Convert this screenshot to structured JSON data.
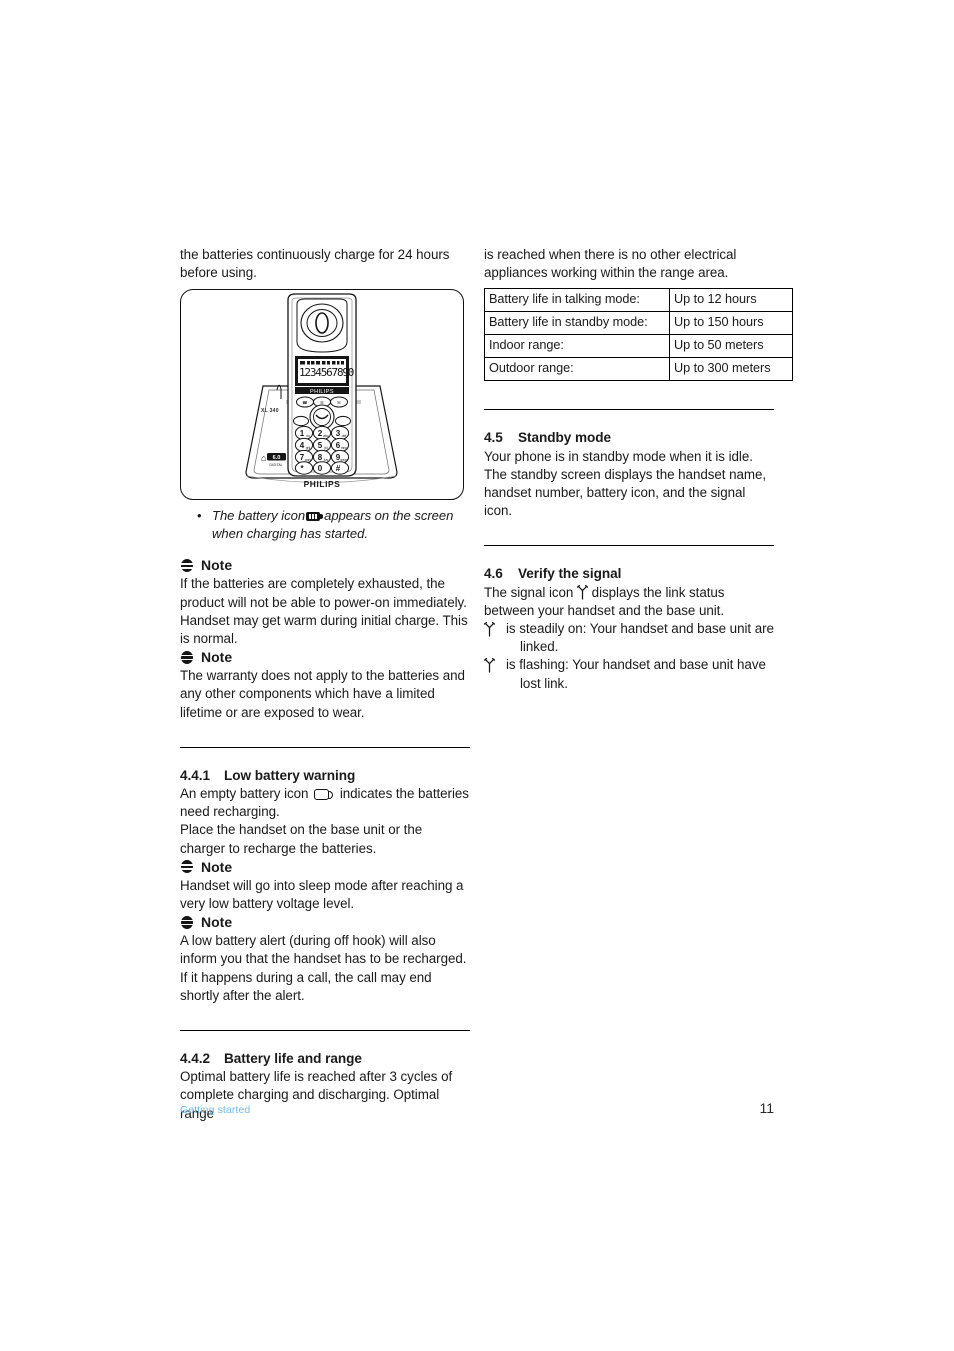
{
  "page": {
    "number": "11",
    "footer_section": "Getting started",
    "footer_link_color": "#6bbdee"
  },
  "left_column": {
    "intro_paragraph": "the batteries continuously charge for 24 hours before using.",
    "figure": {
      "alt": "Cordless handset resting in its charging base",
      "brand": "PHILIPS",
      "base_brand": "PHILIPS",
      "base_model": "XL 340",
      "dect_logo": "DECT 6.0",
      "lcd_digits": "1234567890",
      "keypad": [
        "1",
        "2",
        "3",
        "4",
        "5",
        "6",
        "7",
        "8",
        "9",
        "*",
        "0",
        "#"
      ]
    },
    "caption": {
      "bullet": "•",
      "text_before": "The battery icon",
      "icon": "battery-full-icon",
      "text_after": "appears on the screen when charging has started."
    },
    "note1": {
      "label": "Note",
      "icon": "note-icon",
      "text": "If the batteries are completely exhausted, the product will not be able to power-on immediately. Handset may get warm during initial charge. This is normal."
    },
    "note2": {
      "label": "Note",
      "icon": "note-icon",
      "text": "The warranty does not apply to the batteries and any other components which have a limited lifetime or are exposed to wear."
    },
    "section_441": {
      "number": "4.4.1",
      "title": "Low battery warning",
      "para1_before": "An empty battery icon",
      "para1_icon": "battery-empty-icon",
      "para1_after": "indicates the batteries need recharging.",
      "para2": "Place the handset on the base unit or the charger to recharge the batteries.",
      "note1": {
        "label": "Note",
        "icon": "note-icon",
        "text": "Handset will go into sleep mode after reaching a very low battery voltage level."
      },
      "note2": {
        "label": "Note",
        "icon": "note-icon",
        "text": "A low battery alert (during off hook) will also inform you that the handset has to be recharged. If it happens during a call, the call may end shortly after the alert."
      }
    },
    "section_442": {
      "number": "4.4.2",
      "title": "Battery life and range",
      "para1": "Optimal battery life is reached after 3 cycles of complete charging and discharging. Optimal range"
    }
  },
  "right_column": {
    "continuation_paragraph": "is reached when there is no other electrical appliances working within the range area.",
    "spec_table": {
      "rows": [
        {
          "key": "Battery life in talking mode:",
          "value": "Up to 12 hours"
        },
        {
          "key": "Battery life in standby mode:",
          "value": "Up to 150 hours"
        },
        {
          "key": "Indoor range:",
          "value": "Up to 50 meters"
        },
        {
          "key": "Outdoor range:",
          "value": "Up to 300 meters"
        }
      ]
    },
    "section_45": {
      "number": "4.5",
      "title": "Standby mode",
      "para1": "Your phone is in standby mode when it is idle. The standby screen displays the handset name, handset number, battery icon, and the signal icon."
    },
    "section_46": {
      "number": "4.6",
      "title": "Verify the signal",
      "para1_before": "The signal icon",
      "para1_icon": "signal-antenna-icon",
      "para1_after": "displays the link status between your handset and the base unit.",
      "items": [
        {
          "icon": "signal-antenna-icon",
          "text": "is steadily on: Your handset and base unit are",
          "continuation": "linked."
        },
        {
          "icon": "signal-antenna-icon",
          "text": "is flashing: Your handset and base unit have",
          "continuation": "lost link."
        }
      ]
    }
  }
}
